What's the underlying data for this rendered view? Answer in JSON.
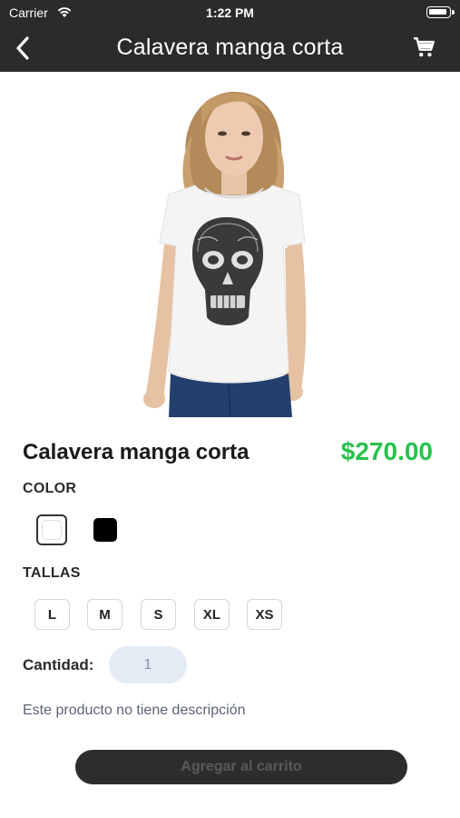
{
  "status_bar": {
    "carrier": "Carrier",
    "time": "1:22 PM"
  },
  "nav": {
    "title": "Calavera manga corta",
    "back_icon": "chevron-left-icon",
    "cart_icon": "shopping-cart-icon"
  },
  "product": {
    "image": "model-wearing-skull-tshirt",
    "name": "Calavera manga corta",
    "price": "$270.00",
    "price_color": "#27c24c",
    "color_label": "COLOR",
    "colors": [
      {
        "name": "white",
        "hex": "#ffffff",
        "selected": true
      },
      {
        "name": "black",
        "hex": "#000000",
        "selected": false
      }
    ],
    "sizes_label": "TALLAS",
    "sizes": [
      "L",
      "M",
      "S",
      "XL",
      "XS"
    ],
    "quantity_label": "Cantidad:",
    "quantity_value": "1",
    "description": "Este producto no tiene descripción"
  },
  "actions": {
    "add_to_cart": "Agregar al carrito"
  }
}
